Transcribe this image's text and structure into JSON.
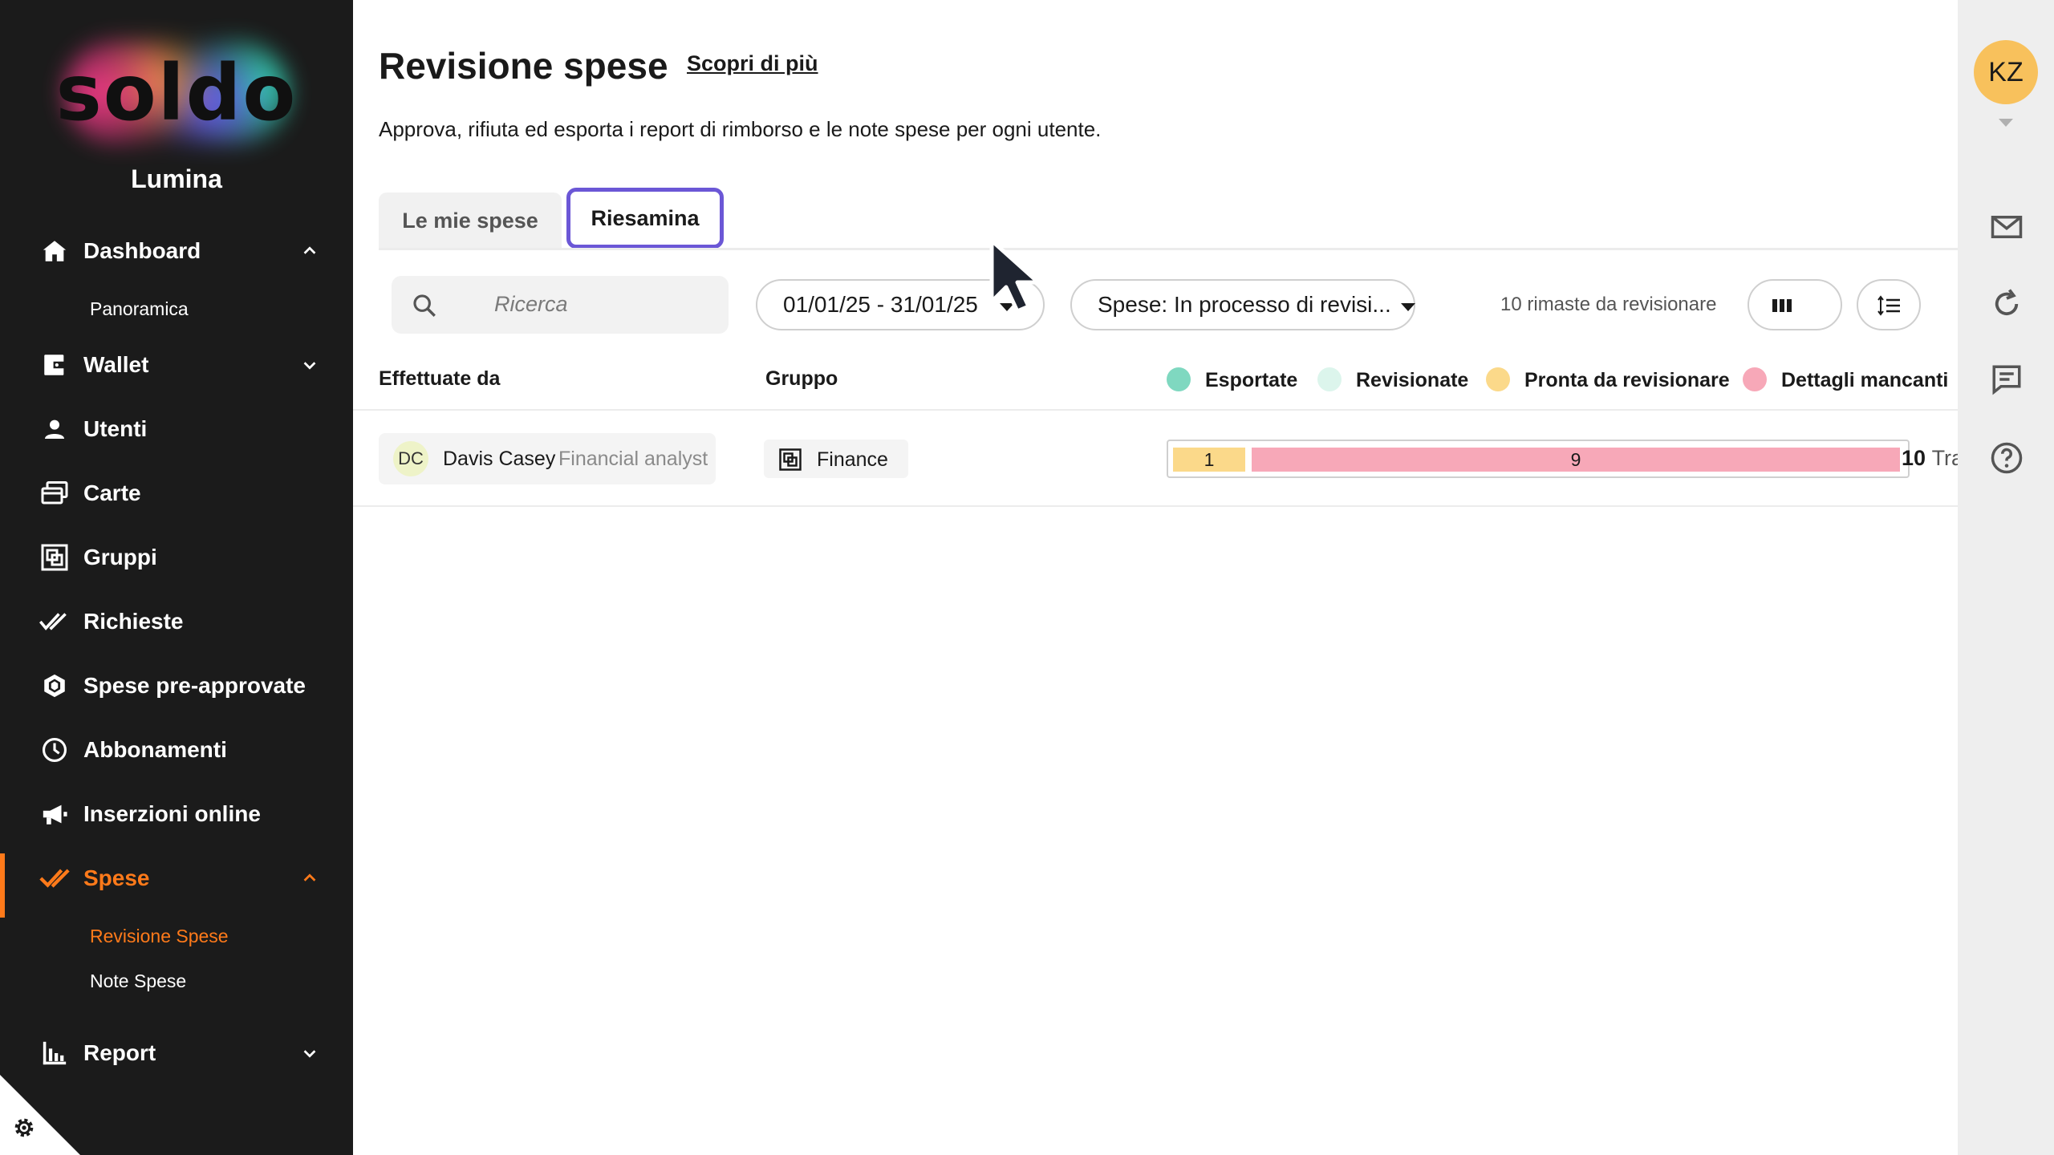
{
  "sidebar": {
    "logo_text": "soldo",
    "org_name": "Lumina",
    "items": [
      {
        "label": "Dashboard",
        "icon": "home-icon",
        "chevron": "up"
      },
      {
        "label": "Wallet",
        "icon": "wallet-icon",
        "chevron": "down"
      },
      {
        "label": "Utenti",
        "icon": "user-icon"
      },
      {
        "label": "Carte",
        "icon": "cards-icon"
      },
      {
        "label": "Gruppi",
        "icon": "group-icon"
      },
      {
        "label": "Richieste",
        "icon": "double-check-icon"
      },
      {
        "label": "Spese pre-approvate",
        "icon": "hexagon-icon"
      },
      {
        "label": "Abbonamenti",
        "icon": "clock-icon"
      },
      {
        "label": "Inserzioni online",
        "icon": "megaphone-icon"
      },
      {
        "label": "Spese",
        "icon": "check-icon",
        "chevron": "up",
        "active": true
      },
      {
        "label": "Report",
        "icon": "chart-icon",
        "chevron": "down"
      }
    ],
    "dashboard_sub": [
      "Panoramica"
    ],
    "spese_sub": [
      "Revisione Spese",
      "Note Spese"
    ]
  },
  "header": {
    "title": "Revisione spese",
    "learn_more": "Scopri di più",
    "subtitle": "Approva, rifiuta ed esporta i report di rimborso e le note spese per ogni utente."
  },
  "tabs": [
    {
      "label": "Le mie spese",
      "active": false
    },
    {
      "label": "Riesamina",
      "active": true
    }
  ],
  "filters": {
    "search_placeholder": "Ricerca",
    "date_range": "01/01/25 - 31/01/25",
    "status": "Spese: In processo di revisi...",
    "remaining": "10 rimaste da revisionare"
  },
  "table": {
    "col_user": "Effettuate da",
    "col_group": "Gruppo",
    "legend": [
      {
        "label": "Esportate",
        "color": "#7fd8c0"
      },
      {
        "label": "Revisionate",
        "color": "#dcf5ec"
      },
      {
        "label": "Pronta da revisionare",
        "color": "#fbd98a"
      },
      {
        "label": "Dettagli mancanti",
        "color": "#f7a8b8"
      }
    ],
    "rows": [
      {
        "initials": "DC",
        "name": "Davis Casey",
        "role": "Financial analyst",
        "group": "Finance",
        "ready": 1,
        "missing": 9,
        "ready_label": "1",
        "missing_label": "9",
        "total": "10",
        "total_suffix": "Tra"
      }
    ]
  },
  "rail": {
    "avatar_initials": "KZ"
  },
  "colors": {
    "accent": "#ff7a1a",
    "tab_focus": "#6b57d6",
    "sidebar_bg": "#1b1b1b"
  }
}
